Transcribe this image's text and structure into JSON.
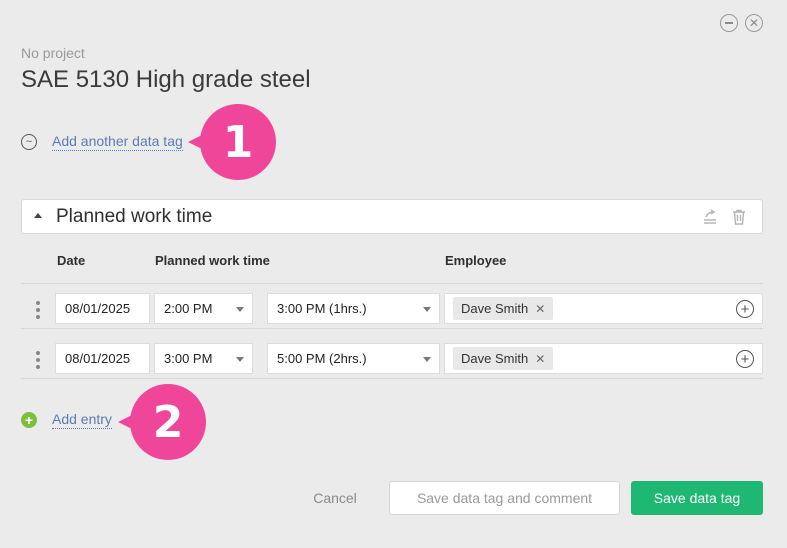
{
  "project_label": "No project",
  "title": "SAE 5130 High grade steel",
  "add_tag_link": "Add another data tag",
  "badges": [
    "1",
    "2"
  ],
  "section": {
    "title": "Planned work time"
  },
  "columns": {
    "date": "Date",
    "work_time": "Planned work time",
    "employee": "Employee"
  },
  "entries": [
    {
      "date": "08/01/2025",
      "start": "2:00 PM",
      "end": "3:00 PM (1hrs.)",
      "employee": "Dave Smith"
    },
    {
      "date": "08/01/2025",
      "start": "3:00 PM",
      "end": "5:00 PM (2hrs.)",
      "employee": "Dave Smith"
    }
  ],
  "add_entry_link": "Add entry",
  "buttons": {
    "cancel": "Cancel",
    "save_comment": "Save data tag and comment",
    "save": "Save data tag"
  },
  "colors": {
    "accent": "#1fb873",
    "link": "#5a7db0",
    "badge": "#f0469a",
    "add_icon": "#7bbf3d"
  },
  "icons": {
    "minimize": "minimize-icon",
    "close": "close-icon",
    "tag": "tilde-icon",
    "collapse": "caret-up-icon",
    "share": "share-icon",
    "delete": "trash-icon",
    "drag": "drag-handle-icon",
    "add_employee": "plus-circle-icon",
    "remove": "close-x-icon",
    "add_entry": "plus-green-icon"
  }
}
